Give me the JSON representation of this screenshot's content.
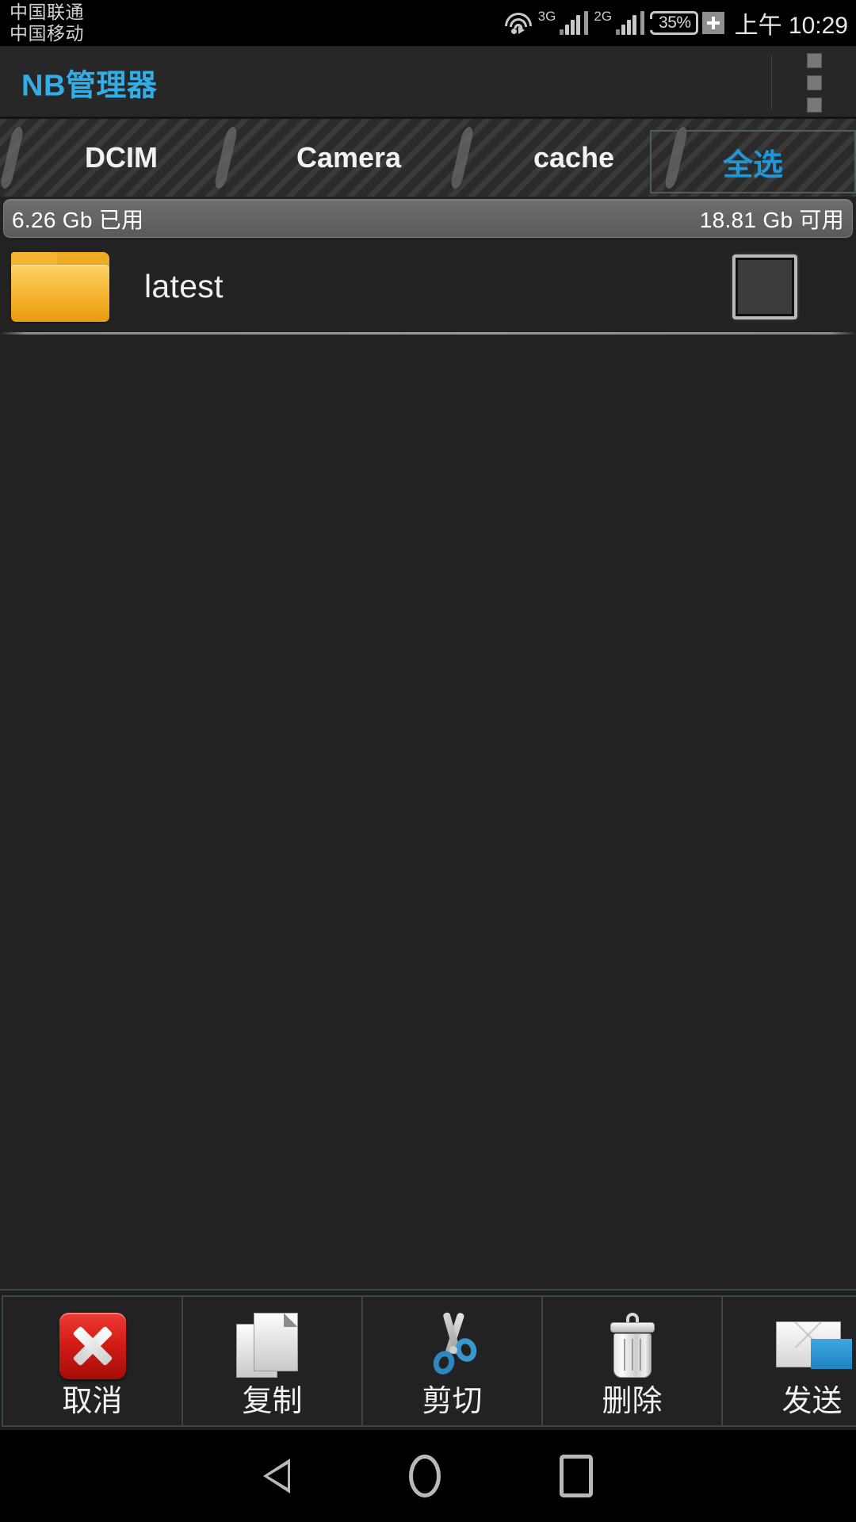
{
  "status_bar": {
    "carriers": [
      "中国联通",
      "中国移动"
    ],
    "wifi_icon": "wifi-icon",
    "sim1_network": "3G",
    "sim2_network": "2G",
    "battery_percent": "35%",
    "battery_charging_icon": "plus-icon",
    "clock": "上午 10:29"
  },
  "app_bar": {
    "title": "NB管理器",
    "title_color": "#33ade6",
    "overflow_icon": "more-vertical-icon"
  },
  "breadcrumb": {
    "items": [
      {
        "label": "DCIM"
      },
      {
        "label": "Camera"
      },
      {
        "label": "cache"
      }
    ],
    "select_all_label": "全选",
    "select_all_color": "#2196d8"
  },
  "storage": {
    "used": "6.26 Gb 已用",
    "available": "18.81 Gb 可用"
  },
  "file_list": {
    "rows": [
      {
        "name": "latest",
        "icon": "folder-icon",
        "checked": false
      }
    ]
  },
  "action_bar": {
    "buttons": [
      {
        "label": "取消",
        "icon": "cancel-icon"
      },
      {
        "label": "复制",
        "icon": "copy-icon"
      },
      {
        "label": "剪切",
        "icon": "scissors-icon"
      },
      {
        "label": "删除",
        "icon": "trash-icon"
      },
      {
        "label": "发送",
        "icon": "envelope-icon"
      }
    ]
  },
  "nav_bar": {
    "back": "back-icon",
    "home": "home-icon",
    "recents": "recents-icon"
  }
}
